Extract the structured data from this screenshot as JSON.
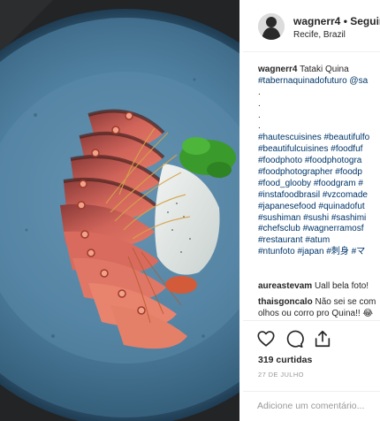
{
  "header": {
    "username": "wagnerr4",
    "separator": "•",
    "follow_label": "Seguindo",
    "location": "Recife, Brazil"
  },
  "caption": {
    "author": "wagnerr4",
    "title": "Tataki Quina",
    "lines": [
      "#tabernaquinadofuturo @sa",
      ".",
      ".",
      ".",
      ".",
      "#hautescuisines #beautifulfo",
      "#beautifulcuisines #foodfuf",
      "#foodphoto #foodphotogra",
      "#foodphotographer #foodp",
      "#food_glooby #foodgram #",
      "#instafoodbrasil #vzcomade",
      "#japanesefood #quinadofut",
      "#sushiman #sushi #sashimi",
      "#chefsclub #wagnerramosf",
      "#restaurant #atum",
      "#ntunfoto #japan #刺身 #マ"
    ]
  },
  "comments": [
    {
      "user": "aureastevam",
      "text": "Uall bela foto!"
    },
    {
      "user": "thaisgoncalo",
      "text": "Não sei se com",
      "continuation": "olhos ou corro pro Quina!! 😂"
    }
  ],
  "actions": {
    "like_icon": "heart-icon",
    "comment_icon": "comment-icon",
    "share_icon": "share-icon"
  },
  "likes_text": "319 curtidas",
  "date_text": "27 DE JULHO",
  "add_comment": {
    "placeholder": "Adicione um comentário..."
  },
  "colors": {
    "hashtag": "#003569",
    "plate": "#4a7d9e",
    "tuna": "#c8584f"
  }
}
